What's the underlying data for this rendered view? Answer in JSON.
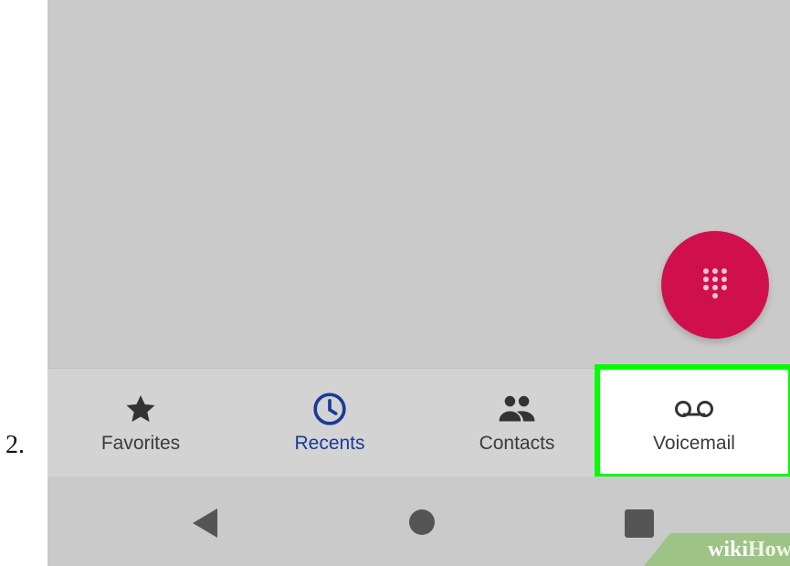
{
  "step_number": "2.",
  "fab": {
    "icon": "dialpad-icon",
    "color": "#d0104c"
  },
  "bottom_nav": {
    "tabs": [
      {
        "label": "Favorites",
        "icon": "star-icon",
        "active": false
      },
      {
        "label": "Recents",
        "icon": "clock-icon",
        "active": true
      },
      {
        "label": "Contacts",
        "icon": "people-icon",
        "active": false
      },
      {
        "label": "Voicemail",
        "icon": "voicemail-icon",
        "active": false,
        "highlighted": true
      }
    ],
    "active_color": "#1a3a98",
    "highlight_color": "#00ff00"
  },
  "system_nav": {
    "buttons": [
      "back-icon",
      "home-icon",
      "recents-square-icon"
    ]
  },
  "watermark": {
    "wiki": "wiki",
    "how": "How"
  }
}
